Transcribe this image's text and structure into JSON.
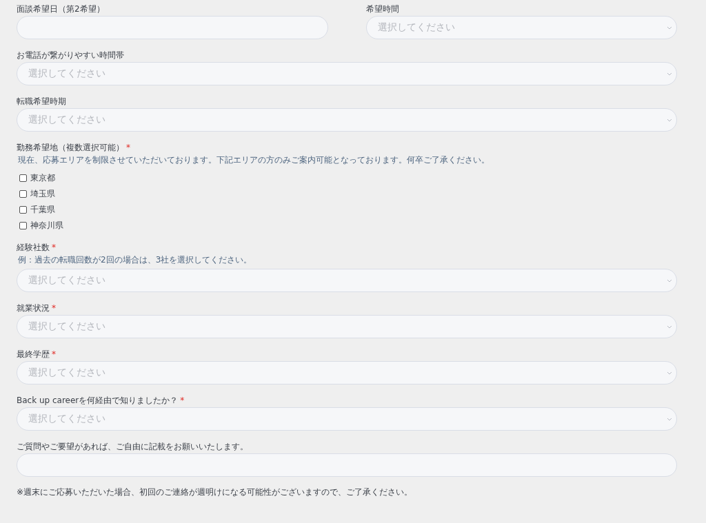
{
  "rows": [
    {
      "fields": [
        {
          "kind": "date",
          "label": "面談希望日（第2希望）"
        },
        {
          "kind": "select",
          "label": "希望時間",
          "placeholder": "選択してください"
        }
      ]
    },
    {
      "fields": [
        {
          "kind": "select",
          "label": "お電話が繋がりやすい時間帯",
          "placeholder": "選択してください"
        }
      ]
    },
    {
      "fields": [
        {
          "kind": "select",
          "label": "転職希望時期",
          "placeholder": "選択してください"
        }
      ]
    },
    {
      "fields": [
        {
          "kind": "checkboxes",
          "label": "勤務希望地（複数選択可能）",
          "required_mark": "*",
          "note": "現在、応募エリアを制限させていただいております。下記エリアの方のみご案内可能となっております。何卒ご了承ください。",
          "options": [
            {
              "label": "東京都",
              "checked": false
            },
            {
              "label": "埼玉県",
              "checked": false
            },
            {
              "label": "千葉県",
              "checked": false
            },
            {
              "label": "神奈川県",
              "checked": false
            }
          ]
        }
      ]
    },
    {
      "fields": [
        {
          "kind": "select",
          "label": "経験社数",
          "required_mark": "*",
          "note": "例：過去の転職回数が2回の場合は、3社を選択してください。",
          "placeholder": "選択してください"
        }
      ]
    },
    {
      "fields": [
        {
          "kind": "select",
          "label": "就業状況",
          "required_mark": "*",
          "placeholder": "選択してください"
        }
      ]
    },
    {
      "fields": [
        {
          "kind": "select",
          "label": "最終学歴",
          "required_mark": "*",
          "placeholder": "選択してください"
        }
      ]
    },
    {
      "fields": [
        {
          "kind": "select",
          "label": "Back up careerを何経由で知りましたか？",
          "required_mark": "*",
          "placeholder": "選択してください"
        }
      ]
    },
    {
      "fields": [
        {
          "kind": "text",
          "label": "ご質問やご要望があれば、ご自由に記載をお願いいたします。"
        }
      ]
    }
  ],
  "footer_note": "※週末にご応募いただいた場合、初回のご連絡が週明けになる可能性がございますので、ご了承ください。"
}
